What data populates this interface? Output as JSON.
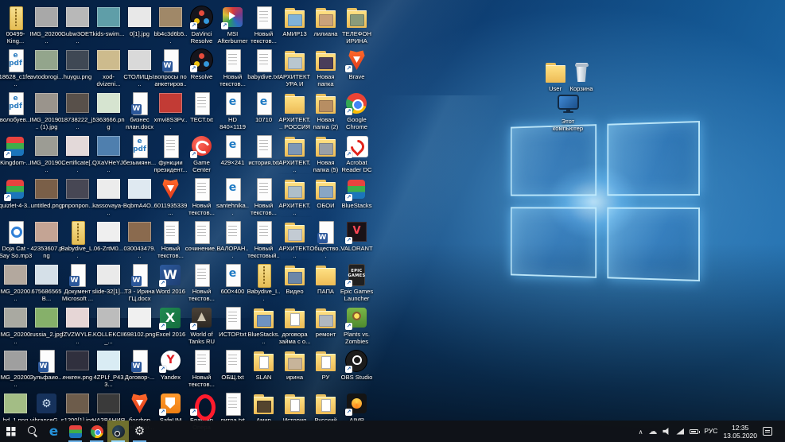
{
  "colors": {
    "taskbar_bg": "#10131 8",
    "accent": "#0078d7",
    "wallpaper_deep": "#0a3160",
    "wallpaper_glow": "#78c8ff",
    "active_app_highlight": "#70702e",
    "folder_yellow": "#edbb55"
  },
  "desktop": {
    "icons": [
      {
        "label": "00499-King...",
        "type": "zip"
      },
      {
        "label": "IMG_20200...",
        "type": "image",
        "tone": "#a8a8a8"
      },
      {
        "label": "Gubw3OET...",
        "type": "image",
        "tone": "#b8b8b8"
      },
      {
        "label": "kids-swim...",
        "type": "image",
        "tone": "#5f9ea8"
      },
      {
        "label": "0[1].jpg",
        "type": "image",
        "tone": "#e8e8e8"
      },
      {
        "label": "bb4c3d6b5...",
        "type": "image",
        "tone": "#a08868"
      },
      {
        "label": "DaVinci Resolve Pro...",
        "type": "davinci",
        "shortcut": true
      },
      {
        "label": "MSI Afterburner",
        "type": "msi",
        "shortcut": true
      },
      {
        "label": "Новый текстов...",
        "type": "text"
      },
      {
        "label": "АМИР13",
        "type": "folder-photo",
        "tone": "#7fb2d9"
      },
      {
        "label": "лилиана",
        "type": "folder-photo",
        "tone": "#c9a27a"
      },
      {
        "label": "ТЕЛЕФОН ИРИНА",
        "type": "folder-photo",
        "tone": "#8a9b7a"
      },
      {
        "label": "18628_c1fe...",
        "type": "epdf"
      },
      {
        "label": "avtodorogi...",
        "type": "image",
        "tone": "#93a58c"
      },
      {
        "label": "huygu.png",
        "type": "image",
        "tone": "#3f4854"
      },
      {
        "label": "xod-dvizeni...",
        "type": "image",
        "tone": "#cdbb8d"
      },
      {
        "label": "СТОЛИЦЫ...",
        "type": "image",
        "tone": "#d9d9d9"
      },
      {
        "label": "вопросы по анкетиров...",
        "type": "word"
      },
      {
        "label": "Resolve",
        "type": "davinci",
        "shortcut": true
      },
      {
        "label": "Новый текстов...",
        "type": "text"
      },
      {
        "label": "babydive.txt",
        "type": "text"
      },
      {
        "label": "АРХИТЕКТУРА И СКУЛЬП...",
        "type": "folder-photo",
        "tone": "#b9c7cf"
      },
      {
        "label": "Новая папка",
        "type": "folder-photo",
        "tone": "#4a3d5a"
      },
      {
        "label": "Brave",
        "type": "brave",
        "shortcut": true
      },
      {
        "label": "волобуев...",
        "type": "epdf"
      },
      {
        "label": "IMG_20190... (1).jpg",
        "type": "image",
        "tone": "#9a948c"
      },
      {
        "label": "18738222_j...",
        "type": "image",
        "tone": "#58504a"
      },
      {
        "label": "5363666.png",
        "type": "image",
        "tone": "#d6e4d0"
      },
      {
        "label": "бизнес план.docx",
        "type": "word"
      },
      {
        "label": "xmvi8S3Pv...",
        "type": "image",
        "tone": "#c23b35"
      },
      {
        "label": "ТЕСТ.txt",
        "type": "text"
      },
      {
        "label": "HD 840×1119",
        "type": "html"
      },
      {
        "label": "10710",
        "type": "html"
      },
      {
        "label": "АРХИТЕКТ... РОССИЯ И...",
        "type": "folder"
      },
      {
        "label": "Новая папка (2)",
        "type": "folder-photo",
        "tone": "#b78e63"
      },
      {
        "label": "Google Chrome",
        "type": "chrome",
        "shortcut": true
      },
      {
        "label": "Kingdom-...",
        "type": "bluestacks",
        "shortcut": true
      },
      {
        "label": "IMG_20190...",
        "type": "image",
        "tone": "#9c9c94"
      },
      {
        "label": "Certificate[...",
        "type": "image",
        "tone": "#e3d9d9"
      },
      {
        "label": "QXaVHeYJ...",
        "type": "image",
        "tone": "#4f7fae"
      },
      {
        "label": "безымянн...",
        "type": "epdf"
      },
      {
        "label": "функции президент...",
        "type": "text"
      },
      {
        "label": "Game Center",
        "type": "gamecenter",
        "shortcut": true
      },
      {
        "label": "429×241",
        "type": "html"
      },
      {
        "label": "история.txt",
        "type": "text"
      },
      {
        "label": "АРХИТЕКТ... ВЛАДИМИР",
        "type": "folder-photo",
        "tone": "#7d97b5"
      },
      {
        "label": "Новая папка (5)",
        "type": "folder-photo",
        "tone": "#9aa0a6"
      },
      {
        "label": "Acrobat Reader DC",
        "type": "acrobat",
        "shortcut": true
      },
      {
        "label": "quizlet-4-3...",
        "type": "bluestacks",
        "shortcut": true
      },
      {
        "label": "untitled.png",
        "type": "image",
        "tone": "#7a5f48"
      },
      {
        "label": "pnponpon...",
        "type": "image",
        "tone": "#474754"
      },
      {
        "label": "kassovaya-...",
        "type": "image",
        "tone": "#ececec"
      },
      {
        "label": "BqbmA4O...",
        "type": "image",
        "tone": "#dfe9f1"
      },
      {
        "label": "6011935339...",
        "type": "brave"
      },
      {
        "label": "Новый текстов...",
        "type": "text"
      },
      {
        "label": "santehnika...",
        "type": "html"
      },
      {
        "label": "Новый текстов...",
        "type": "text"
      },
      {
        "label": "АРХИТЕКТ... НОВГОРОД",
        "type": "folder-photo",
        "tone": "#aebfc9"
      },
      {
        "label": "ОБОИ",
        "type": "folder-photo",
        "tone": "#88a6c5"
      },
      {
        "label": "BlueStacks",
        "type": "bluestacks",
        "shortcut": true
      },
      {
        "label": "Doja Cat - Say So.mp3",
        "type": "audio"
      },
      {
        "label": "42353607.png",
        "type": "image",
        "tone": "#c4a494"
      },
      {
        "label": "Babydive_L..",
        "type": "zip"
      },
      {
        "label": "06-ZrtM0...",
        "type": "image",
        "tone": "#efefef"
      },
      {
        "label": "030043479...",
        "type": "image",
        "tone": "#8a6a4e"
      },
      {
        "label": "Новый текстов...",
        "type": "text"
      },
      {
        "label": "сочинение..",
        "type": "text"
      },
      {
        "label": "ВАЛОРАН...",
        "type": "text"
      },
      {
        "label": "Новый текстовый..",
        "type": "text"
      },
      {
        "label": "АРХИТЕКТ... СКУЛЬПТУ..",
        "type": "folder-photo",
        "tone": "#c3cbd3"
      },
      {
        "label": "Общество...",
        "type": "word"
      },
      {
        "label": "VALORANT",
        "type": "valorant",
        "shortcut": true
      },
      {
        "label": "IMG_20200...",
        "type": "image",
        "tone": "#b3a89e"
      },
      {
        "label": "675686565B...",
        "type": "image",
        "tone": "#d5e0e8"
      },
      {
        "label": "Документ Microsoft ...",
        "type": "word"
      },
      {
        "label": "slide-32[1]...",
        "type": "image",
        "tone": "#eaeaea"
      },
      {
        "label": "ТЗ - Ирина ГЦ.docx",
        "type": "word"
      },
      {
        "label": "Word 2016",
        "type": "word-app",
        "shortcut": true
      },
      {
        "label": "Новый текстов...",
        "type": "text"
      },
      {
        "label": "600×400",
        "type": "html"
      },
      {
        "label": "Babydive_I...",
        "type": "zip"
      },
      {
        "label": "Видео",
        "type": "folder-photo",
        "tone": "#6b87a8"
      },
      {
        "label": "ПАПА",
        "type": "folder"
      },
      {
        "label": "Epic Games Launcher",
        "type": "epic",
        "shortcut": true
      },
      {
        "label": "IMG_20200...",
        "type": "image",
        "tone": "#a9a9a1"
      },
      {
        "label": "russia_2.jpg",
        "type": "image",
        "tone": "#86b06a"
      },
      {
        "label": "fZVZWYLE...",
        "type": "image",
        "tone": "#e6d6d6"
      },
      {
        "label": "KOLLEKCII_...",
        "type": "image",
        "tone": "#bcbcbc"
      },
      {
        "label": "698102.png",
        "type": "image",
        "tone": "#f0f0f0"
      },
      {
        "label": "Excel 2016",
        "type": "excel-app",
        "shortcut": true
      },
      {
        "label": "World of Tanks RU",
        "type": "wot",
        "shortcut": true
      },
      {
        "label": "ИСТОР.txt",
        "type": "text"
      },
      {
        "label": "BlueStacks...",
        "type": "folder-photo",
        "tone": "#6f93c0"
      },
      {
        "label": "договора займа с о...",
        "type": "folder-doc"
      },
      {
        "label": "ремонт",
        "type": "folder-photo",
        "tone": "#b0b8c0"
      },
      {
        "label": "Plants vs. Zombies",
        "type": "pvz",
        "shortcut": true
      },
      {
        "label": "IMG_20200...",
        "type": "image",
        "tone": "#9f9f9f"
      },
      {
        "label": "Зульфаио...",
        "type": "word"
      },
      {
        "label": "енкген.png",
        "type": "image",
        "tone": "#30303e"
      },
      {
        "label": "4ZPLf_P433...",
        "type": "image",
        "tone": "#d9ecf4"
      },
      {
        "label": "Договор-...",
        "type": "word"
      },
      {
        "label": "Yandex",
        "type": "yandex",
        "shortcut": true
      },
      {
        "label": "Новый текстов...",
        "type": "text"
      },
      {
        "label": "ОБЩ.txt",
        "type": "text"
      },
      {
        "label": "SLAN",
        "type": "folder-doc"
      },
      {
        "label": "ирина",
        "type": "folder-photo",
        "tone": "#c7b49a"
      },
      {
        "label": "РУ",
        "type": "folder-doc"
      },
      {
        "label": "OBS Studio",
        "type": "obs",
        "shortcut": true
      },
      {
        "label": "hd_1.png",
        "type": "image",
        "tone": "#a3bd85"
      },
      {
        "label": "vibranceG...",
        "type": "gearapp"
      },
      {
        "label": "s1200[1].jpg",
        "type": "image",
        "tone": "#6d5c4b"
      },
      {
        "label": "НАЗВАНИЯ РОССИИ.jpg",
        "type": "image",
        "tone": "#3a3a3a"
      },
      {
        "label": "босфор мебельн...",
        "type": "brave"
      },
      {
        "label": "SafeUM",
        "type": "safeum",
        "shortcut": true
      },
      {
        "label": "Браузер Опера",
        "type": "opera",
        "shortcut": true
      },
      {
        "label": "литра.txt",
        "type": "text"
      },
      {
        "label": "Амир",
        "type": "folder-photo",
        "tone": "#54442e"
      },
      {
        "label": "История",
        "type": "folder-doc"
      },
      {
        "label": "Русский",
        "type": "folder-doc"
      },
      {
        "label": "AIMP",
        "type": "aimp",
        "shortcut": true
      }
    ],
    "right_icons": [
      {
        "label": "User",
        "type": "folder"
      },
      {
        "label": "Корзина",
        "type": "recycle"
      },
      {
        "label": "Этот компьютер",
        "type": "thispc"
      }
    ]
  },
  "taskbar": {
    "items": [
      {
        "name": "start",
        "running": false
      },
      {
        "name": "search",
        "running": false
      },
      {
        "name": "edge",
        "running": false
      },
      {
        "name": "bluestacks",
        "running": true
      },
      {
        "name": "chrome",
        "running": true
      },
      {
        "name": "steam",
        "running": true,
        "active": true
      },
      {
        "name": "settings",
        "running": true
      }
    ],
    "tray": {
      "icons": [
        "hidden-icons-caret",
        "onedrive",
        "volume",
        "network",
        "battery"
      ],
      "language": "РУС",
      "time": "12:35",
      "date": "13.05.2020"
    }
  }
}
